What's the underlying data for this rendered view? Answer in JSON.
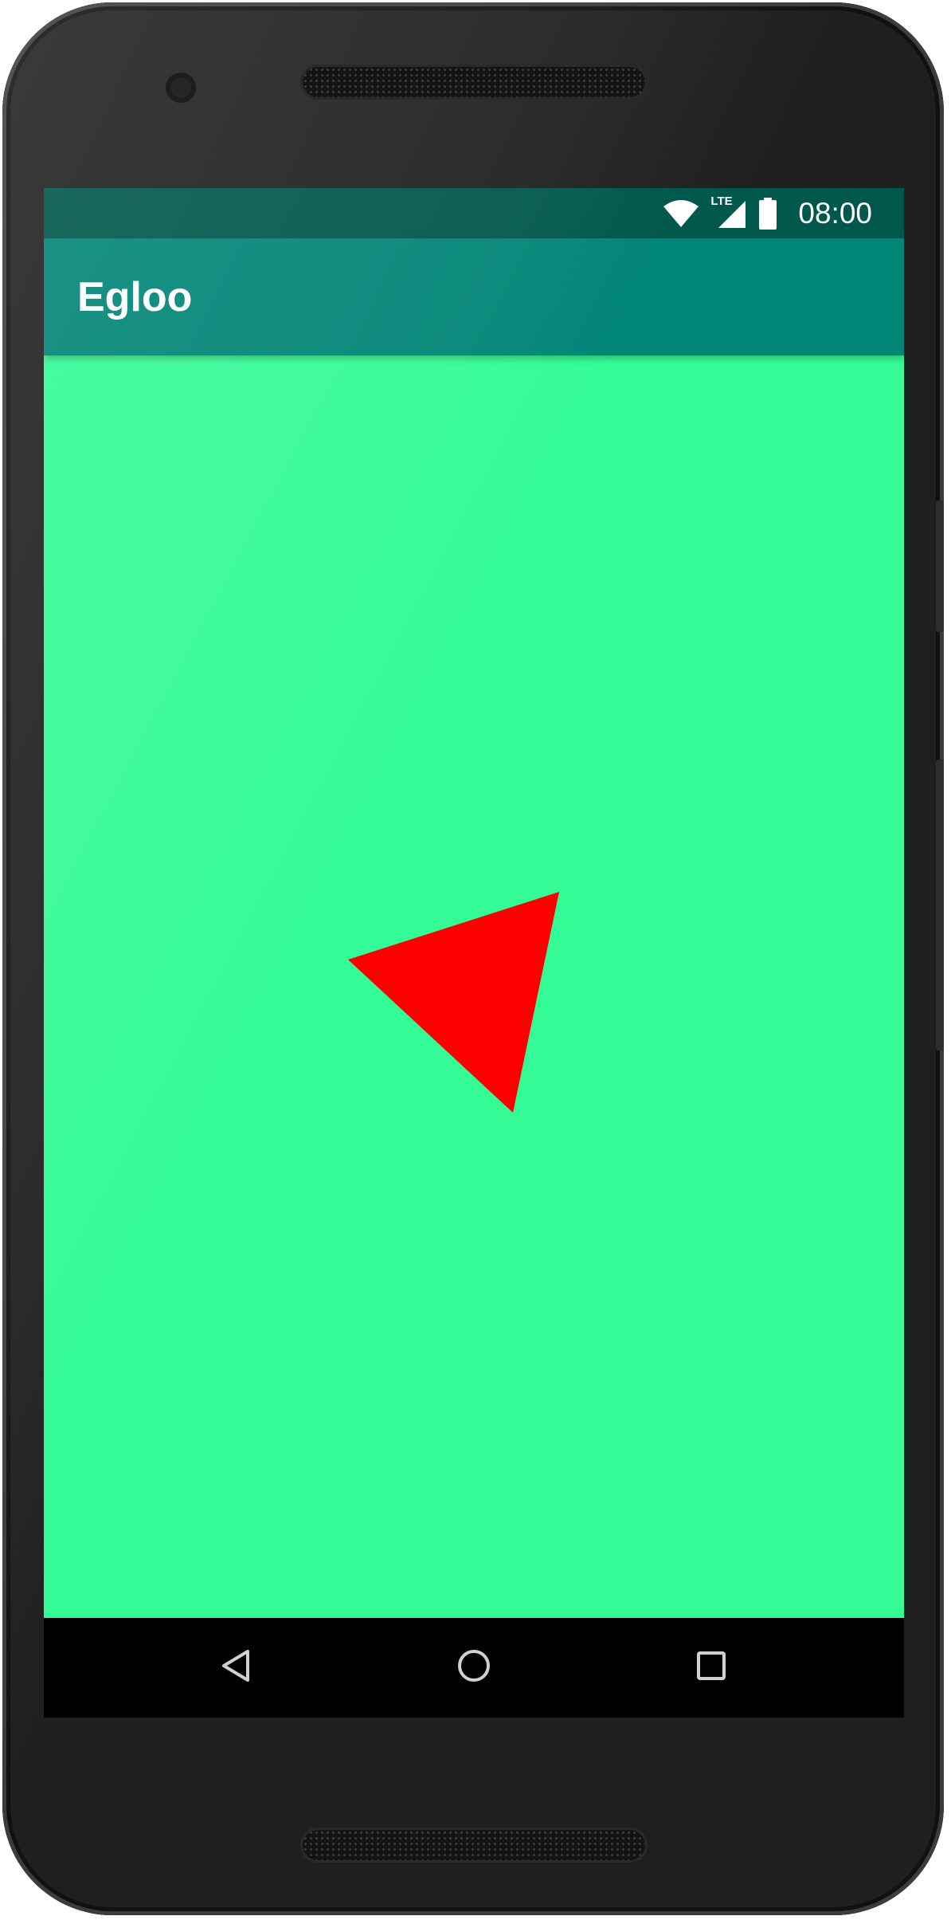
{
  "device": {
    "frame_color": "#1f1f1f"
  },
  "status_bar": {
    "time": "08:00",
    "network_label": "LTE",
    "background_color": "#00574b",
    "icons": [
      "wifi-icon",
      "lte-signal-icon",
      "battery-icon"
    ]
  },
  "app_bar": {
    "title": "Egloo",
    "background_color": "#008577"
  },
  "content": {
    "background_color": "#34fb96",
    "shape": {
      "type": "triangle",
      "color": "#ff0000"
    }
  },
  "nav_bar": {
    "background_color": "#000000",
    "icons": [
      "back-icon",
      "home-icon",
      "recents-icon"
    ]
  }
}
